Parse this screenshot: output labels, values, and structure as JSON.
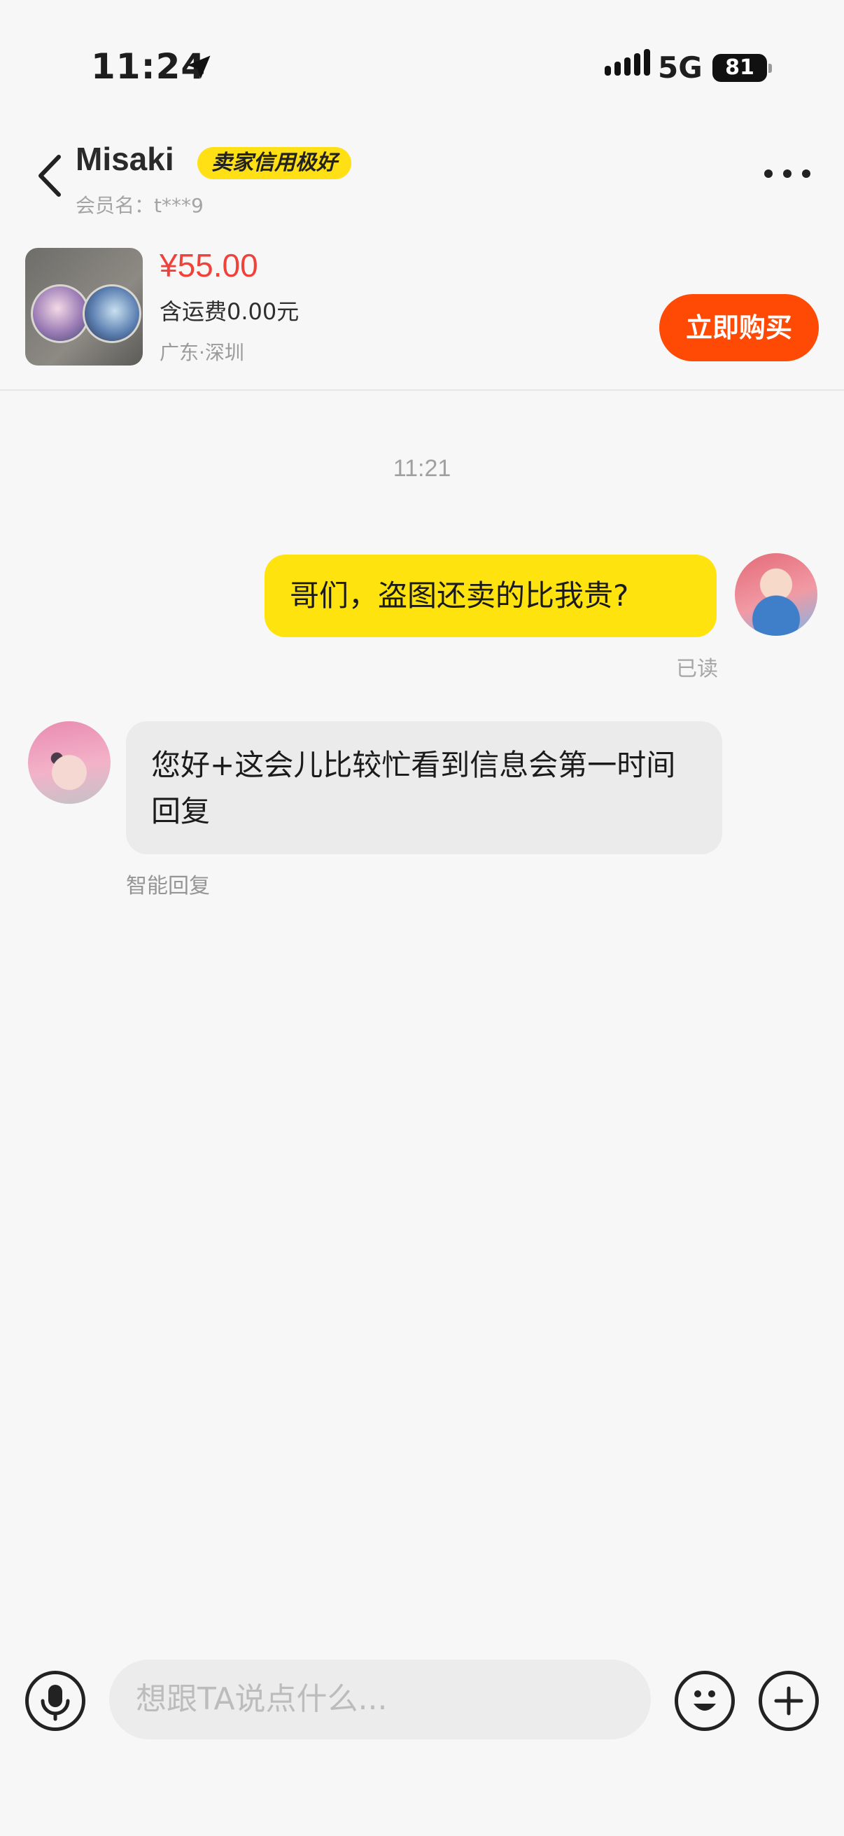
{
  "status_bar": {
    "time": "11:24",
    "network": "5G",
    "battery": "81"
  },
  "header": {
    "title": "Misaki",
    "badge": "卖家信用极好",
    "member_label": "会员名：t***9"
  },
  "product": {
    "price": "¥55.00",
    "shipping": "含运费0.00元",
    "location": "广东·深圳",
    "buy_label": "立即购买"
  },
  "chat": {
    "timestamp": "11:21",
    "messages": [
      {
        "from": "me",
        "text": "哥们，盗图还卖的比我贵?",
        "status": "已读"
      },
      {
        "from": "seller",
        "text": "您好+这会儿比较忙看到信息会第一时间回复",
        "note": "智能回复"
      }
    ]
  },
  "input_bar": {
    "placeholder": "想跟TA说点什么..."
  },
  "colors": {
    "accent_yellow": "#ffe30f",
    "buy_button": "#ff4a06",
    "price_red": "#f0413a",
    "background": "#f7f7f7"
  },
  "icons": [
    "location-arrow-icon",
    "signal-icon",
    "battery-icon",
    "back-icon",
    "more-icon",
    "microphone-icon",
    "emoji-icon",
    "plus-icon"
  ]
}
